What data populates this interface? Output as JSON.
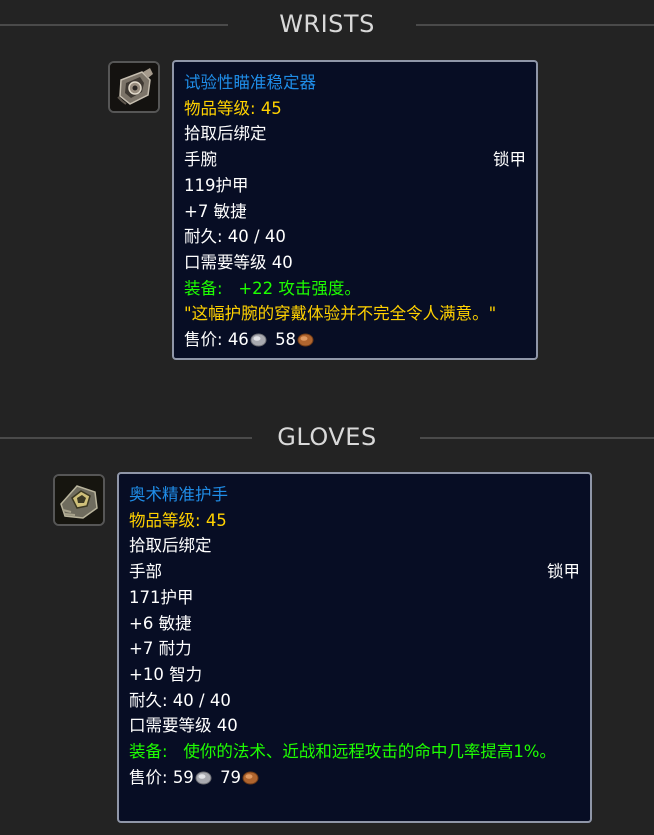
{
  "sections": [
    {
      "header": "WRISTS",
      "item": {
        "icon": "bracer-icon",
        "name": "试验性瞄准稳定器",
        "item_level_label": "物品等级:",
        "item_level_value": "45",
        "binding": "拾取后绑定",
        "slot": "手腕",
        "armor_type": "锁甲",
        "armor": "119护甲",
        "stats": [
          "+7 敏捷"
        ],
        "durability": "耐久: 40 / 40",
        "requirement": "口需要等级 40",
        "equip_label": "装备:",
        "equip_text": "+22 攻击强度。",
        "flavor": "\"这幅护腕的穿戴体验并不完全令人满意。\"",
        "sell_label": "售价:",
        "sell_silver": "46",
        "sell_copper": "58"
      }
    },
    {
      "header": "GLOVES",
      "item": {
        "icon": "gauntlet-icon",
        "name": "奥术精准护手",
        "item_level_label": "物品等级:",
        "item_level_value": "45",
        "binding": "拾取后绑定",
        "slot": "手部",
        "armor_type": "锁甲",
        "armor": "171护甲",
        "stats": [
          "+6 敏捷",
          "+7 耐力",
          "+10 智力"
        ],
        "durability": "耐久: 40 / 40",
        "requirement": "口需要等级 40",
        "equip_label": "装备:",
        "equip_text": "使你的法术、近战和远程攻击的命中几率提高1%。",
        "sell_label": "售价:",
        "sell_silver": "59",
        "sell_copper": "79"
      }
    }
  ],
  "colors": {
    "background": "#232323",
    "tooltip_bg": "#070d24",
    "tooltip_border": "#8f96a8",
    "item_name": "#1f8ce6",
    "item_level": "#ffd100",
    "equip_effect": "#1eff00",
    "flavor": "#ffd100",
    "text": "#ffffff",
    "header_text": "#d9d9d9"
  }
}
